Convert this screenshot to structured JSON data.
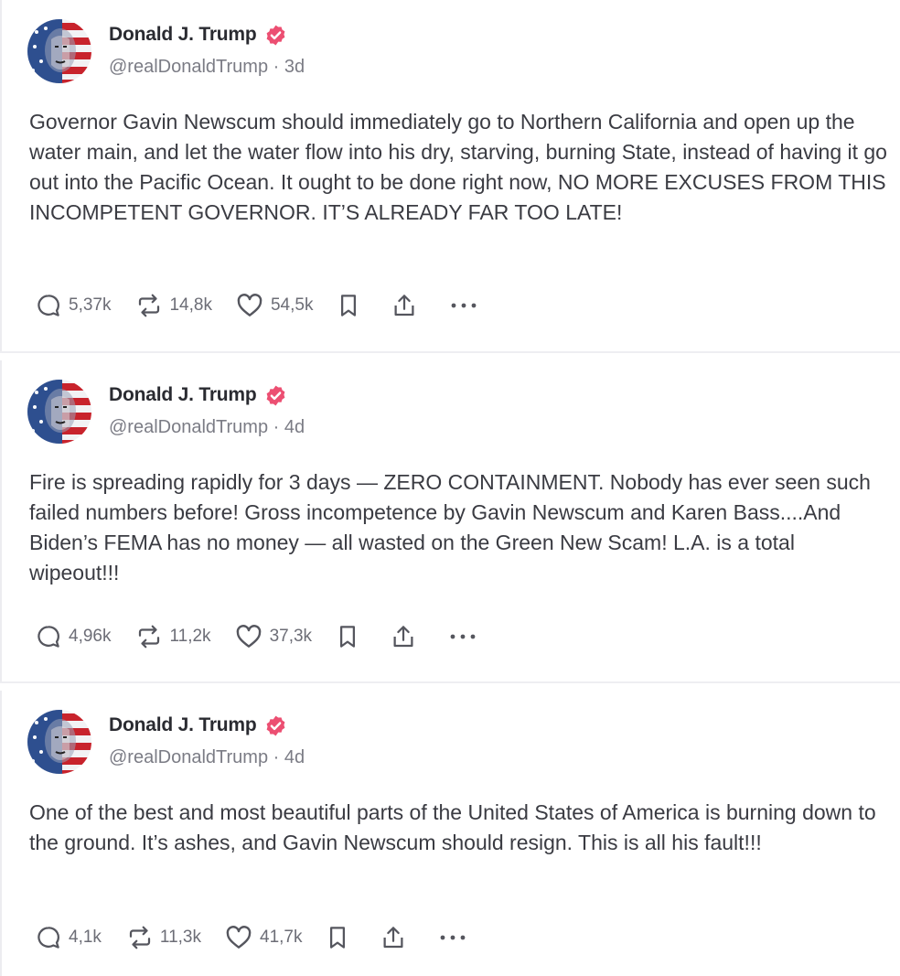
{
  "posts": [
    {
      "author": {
        "name": "Donald J. Trump",
        "handle": "@realDonaldTrump",
        "time": "3d"
      },
      "text": "Governor Gavin Newscum should immediately go to Northern California and open up the water main, and let the water flow into his dry, starving, burning State, instead of having it go out into the Pacific Ocean. It ought to be done right now, NO MORE EXCUSES FROM THIS INCOMPETENT GOVERNOR. IT’S ALREADY FAR TOO LATE!",
      "stats": {
        "replies": "5,37k",
        "reposts": "14,8k",
        "likes": "54,5k"
      }
    },
    {
      "author": {
        "name": "Donald J. Trump",
        "handle": "@realDonaldTrump",
        "time": "4d"
      },
      "text": "Fire is spreading rapidly for 3 days — ZERO CONTAINMENT. Nobody has ever seen such failed numbers before! Gross incompetence by Gavin Newscum and Karen Bass....And Biden’s FEMA has no money — all wasted on the Green New Scam! L.A. is a total wipeout!!!",
      "stats": {
        "replies": "4,96k",
        "reposts": "11,2k",
        "likes": "37,3k"
      }
    },
    {
      "author": {
        "name": "Donald J. Trump",
        "handle": "@realDonaldTrump",
        "time": "4d"
      },
      "text": "One of the best and most beautiful parts of the United States of America is burning down to the ground. It’s ashes, and Gavin Newscum should resign. This is all his fault!!!",
      "stats": {
        "replies": "4,1k",
        "reposts": "11,3k",
        "likes": "41,7k"
      }
    }
  ],
  "theme": {
    "verified_color": "#ec4f72",
    "text_color": "#3a3b42",
    "muted_color": "#7b7c85",
    "icon_color": "#55565e"
  },
  "icons": {
    "reply": "speech-bubble-icon",
    "repost": "repost-arrows-icon",
    "like": "heart-icon",
    "bookmark": "bookmark-icon",
    "share": "share-upload-icon",
    "more": "ellipsis-icon"
  }
}
